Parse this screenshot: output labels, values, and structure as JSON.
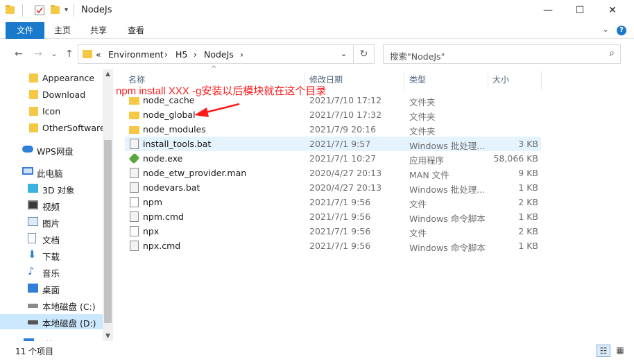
{
  "window": {
    "title": "NodeJs",
    "controls": {
      "minimize": "—",
      "maximize": "☐",
      "close": "✕"
    }
  },
  "ribbon": {
    "tabs": [
      "文件",
      "主页",
      "共享",
      "查看"
    ],
    "expand": "⌄",
    "help": "?"
  },
  "nav": {
    "back": "←",
    "forward": "→",
    "recent": "⌄",
    "up": "↑",
    "breadcrumb": [
      "«",
      "Environment",
      "›",
      "H5",
      "›",
      "NodeJs",
      "›"
    ],
    "dropdown": "⌄",
    "refresh": "↻",
    "search_placeholder": "搜索\"NodeJs\"",
    "search_icon": "⌕"
  },
  "sidebar": {
    "items": [
      {
        "label": "Appearance",
        "icon": "folder-icon"
      },
      {
        "label": "Download",
        "icon": "folder-icon"
      },
      {
        "label": "Icon",
        "icon": "folder-icon"
      },
      {
        "label": "OtherSoftware",
        "icon": "folder-icon"
      },
      {
        "label": "WPS网盘",
        "icon": "cloud-icon"
      },
      {
        "label": "此电脑",
        "icon": "computer-icon"
      },
      {
        "label": "3D 对象",
        "icon": "cube-icon"
      },
      {
        "label": "视频",
        "icon": "video-icon"
      },
      {
        "label": "图片",
        "icon": "picture-icon"
      },
      {
        "label": "文档",
        "icon": "document-icon"
      },
      {
        "label": "下载",
        "icon": "download-icon"
      },
      {
        "label": "音乐",
        "icon": "music-icon"
      },
      {
        "label": "桌面",
        "icon": "desktop-icon"
      },
      {
        "label": "本地磁盘 (C:)",
        "icon": "drive-icon"
      },
      {
        "label": "本地磁盘 (D:)",
        "icon": "drive-icon"
      },
      {
        "label": "网络",
        "icon": "network-icon"
      }
    ],
    "scroll_up": "▲",
    "scroll_down": "▼"
  },
  "file_list": {
    "headers": {
      "name": "名称",
      "date": "修改日期",
      "type": "类型",
      "size": "大小"
    },
    "sort_indicator": "^",
    "annotation": "npm install XXX -g安装以后模块就在这个目录",
    "rows": [
      {
        "name": "node_cache",
        "date": "2021/7/10 17:12",
        "type": "文件夹",
        "size": "",
        "icon": "folder"
      },
      {
        "name": "node_global",
        "date": "2021/7/10 17:32",
        "type": "文件夹",
        "size": "",
        "icon": "folder"
      },
      {
        "name": "node_modules",
        "date": "2021/7/9 20:16",
        "type": "文件夹",
        "size": "",
        "icon": "folder"
      },
      {
        "name": "install_tools.bat",
        "date": "2021/7/1 9:57",
        "type": "Windows 批处理...",
        "size": "3 KB",
        "icon": "bat"
      },
      {
        "name": "node.exe",
        "date": "2021/7/1 10:27",
        "type": "应用程序",
        "size": "58,066 KB",
        "icon": "exe"
      },
      {
        "name": "node_etw_provider.man",
        "date": "2020/4/27 20:13",
        "type": "MAN 文件",
        "size": "9 KB",
        "icon": "bat"
      },
      {
        "name": "nodevars.bat",
        "date": "2020/4/27 20:13",
        "type": "Windows 批处理...",
        "size": "1 KB",
        "icon": "bat"
      },
      {
        "name": "npm",
        "date": "2021/7/1 9:56",
        "type": "文件",
        "size": "2 KB",
        "icon": "doc"
      },
      {
        "name": "npm.cmd",
        "date": "2021/7/1 9:56",
        "type": "Windows 命令脚本",
        "size": "1 KB",
        "icon": "bat"
      },
      {
        "name": "npx",
        "date": "2021/7/1 9:56",
        "type": "文件",
        "size": "2 KB",
        "icon": "doc"
      },
      {
        "name": "npx.cmd",
        "date": "2021/7/1 9:56",
        "type": "Windows 命令脚本",
        "size": "1 KB",
        "icon": "bat"
      }
    ]
  },
  "status": {
    "item_count": "11 个项目",
    "details_view": "☷",
    "icons_view": "▦"
  },
  "colors": {
    "accent": "#1979ca",
    "folder": "#f5c846",
    "selection": "#cce8ff",
    "annotation": "#ff1a1a"
  }
}
